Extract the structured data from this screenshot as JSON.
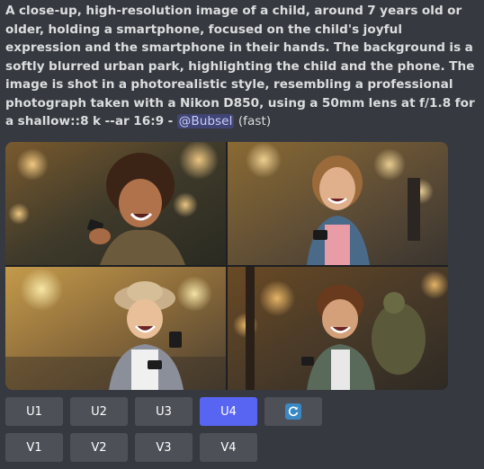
{
  "message": {
    "prompt_text": "A close-up, high-resolution image of a child, around 7 years old or older, holding a smartphone, focused on the child's joyful expression and the smartphone in their hands. The background is a softly blurred urban park, highlighting the child and the phone. The image is shot in a photorealistic style, resembling a professional photograph taken with a Nikon D850, using a 50mm lens at f/1.8 for a shallow::8 k --ar 16:9 - ",
    "mention": "@Bubsel",
    "speed": "(fast)"
  },
  "image_grid": {
    "tiles": [
      {
        "label": "image-1"
      },
      {
        "label": "image-2"
      },
      {
        "label": "image-3"
      },
      {
        "label": "image-4"
      }
    ]
  },
  "buttons": {
    "upscale": [
      "U1",
      "U2",
      "U3",
      "U4"
    ],
    "variation": [
      "V1",
      "V2",
      "V3",
      "V4"
    ],
    "active_upscale": "U4",
    "reroll_icon": "refresh-icon"
  },
  "colors": {
    "background": "#36393f",
    "button": "#4e5058",
    "button_active": "#5865f2",
    "mention_bg": "#5865f24d",
    "reroll_icon_bg": "#3b88c3"
  }
}
